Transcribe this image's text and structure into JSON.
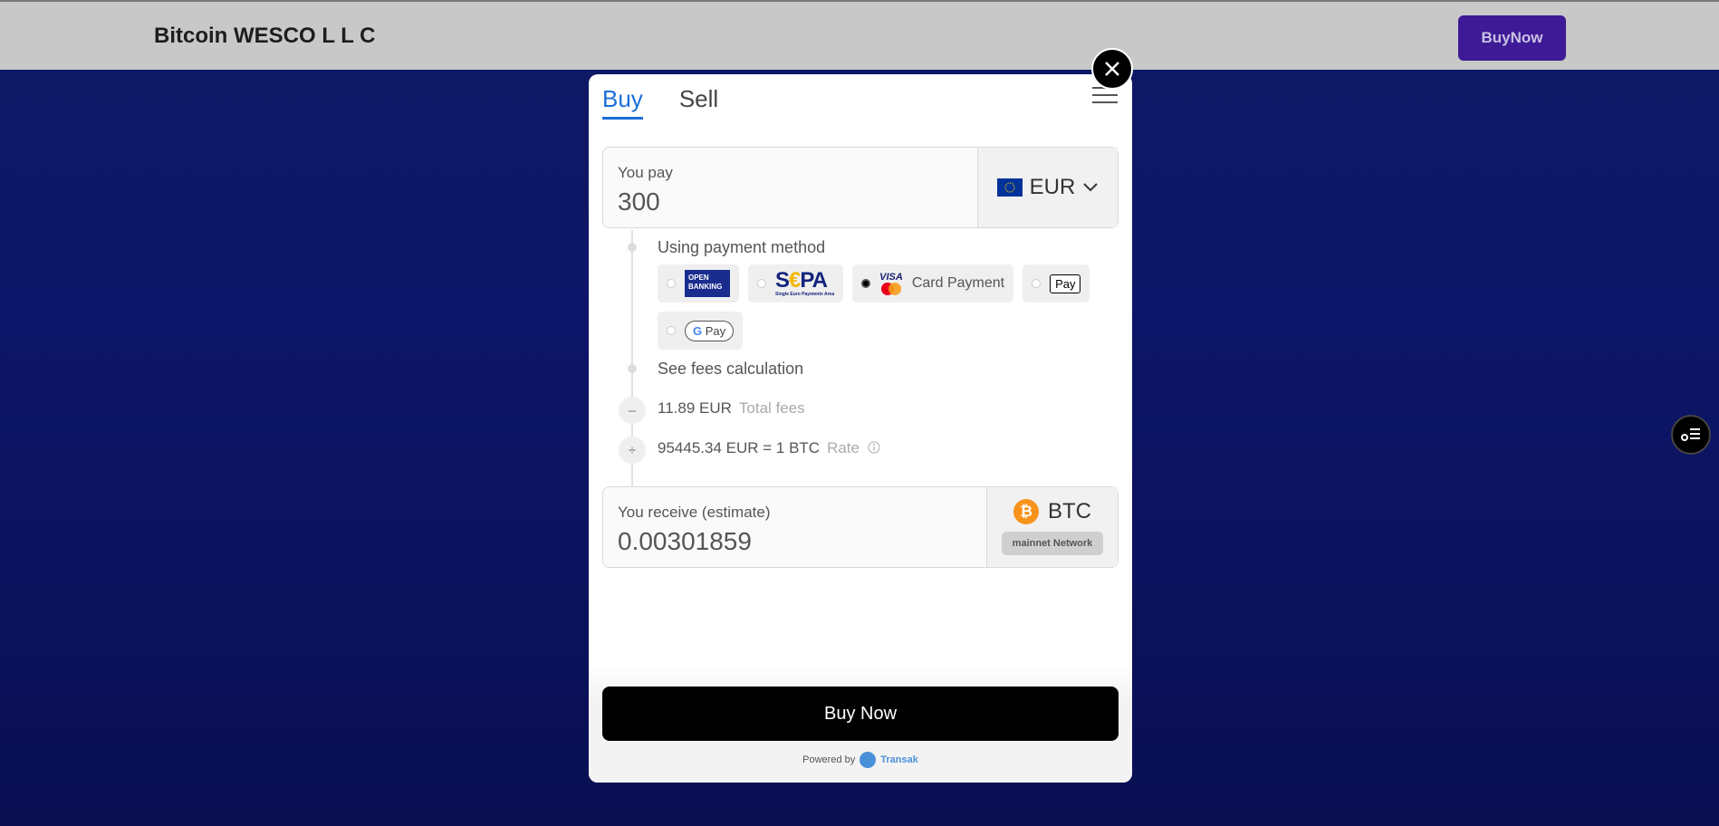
{
  "header": {
    "brand": "Bitcoin WESCO L L C",
    "buy_now_label": "BuyNow"
  },
  "modal": {
    "tabs": [
      {
        "label": "Buy",
        "active": true
      },
      {
        "label": "Sell",
        "active": false
      }
    ],
    "pay": {
      "label": "You pay",
      "value": "300",
      "currency": "EUR",
      "flag_icon": "eu-flag-icon"
    },
    "payment_method": {
      "label": "Using payment method",
      "options": [
        {
          "name": "Open Banking",
          "logo_text": "OPEN BANKING",
          "selected": false
        },
        {
          "name": "SEPA",
          "logo_text": "SEPA",
          "logo_sub": "Single Euro Payments Area",
          "selected": false
        },
        {
          "name": "Card Payment",
          "label": "Card Payment",
          "logo_text": "VISA",
          "selected": true
        },
        {
          "name": "Apple Pay",
          "logo_text": "Pay",
          "selected": false
        },
        {
          "name": "Google Pay",
          "logo_text": "Pay",
          "selected": false
        }
      ]
    },
    "fees": {
      "see_fees_label": "See fees calculation",
      "total_fees_value": "11.89 EUR",
      "total_fees_label": "Total fees",
      "rate_value": "95445.34 EUR = 1 BTC",
      "rate_label": "Rate"
    },
    "receive": {
      "label": "You receive (estimate)",
      "value": "0.00301859",
      "currency": "BTC",
      "network": "mainnet Network"
    },
    "buy_now_label": "Buy Now",
    "powered_by_label": "Powered by",
    "powered_by_brand": "Transak"
  },
  "colors": {
    "accent": "#1a6ed8",
    "brand_purple": "#3e1a96",
    "btc_orange": "#f7931a"
  }
}
